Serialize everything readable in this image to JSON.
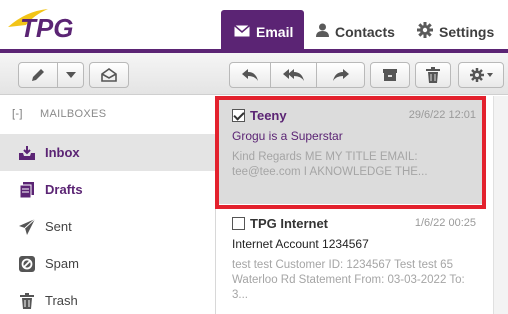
{
  "header": {
    "logo_text": "TPG",
    "tabs": [
      {
        "label": "Email",
        "icon": "envelope-icon",
        "active": true
      },
      {
        "label": "Contacts",
        "icon": "person-icon",
        "active": false
      },
      {
        "label": "Settings",
        "icon": "gear-icon",
        "active": false
      }
    ]
  },
  "toolbar": {
    "buttons": [
      "compose-icon",
      "chevron-down-icon",
      "mark-read-icon",
      "reply-icon",
      "reply-all-icon",
      "forward-icon",
      "archive-icon",
      "trash-icon",
      "gear-icon"
    ]
  },
  "sidebar": {
    "toggle": "[-]",
    "heading": "MAILBOXES",
    "folders": [
      {
        "label": "Inbox",
        "icon": "inbox-icon",
        "active": true
      },
      {
        "label": "Drafts",
        "icon": "drafts-icon",
        "active": false
      },
      {
        "label": "Sent",
        "icon": "send-icon",
        "active": false
      },
      {
        "label": "Spam",
        "icon": "spam-icon",
        "active": false
      },
      {
        "label": "Trash",
        "icon": "trash-icon",
        "active": false
      }
    ]
  },
  "messages": [
    {
      "sender": "Teeny",
      "date": "29/6/22 12:01",
      "subject": "Grogu is a Superstar",
      "preview": "Kind Regards ME MY TITLE EMAIL: tee@tee.com I AKNOWLEDGE THE...",
      "checked": true,
      "selected": true
    },
    {
      "sender": "TPG Internet",
      "date": "1/6/22 00:25",
      "subject": "Internet Account 1234567",
      "preview": "test test Customer ID: 1234567 Test test 65 Waterloo Rd Statement From: 03-03-2022 To: 3...",
      "checked": false,
      "selected": false
    }
  ],
  "colors": {
    "brand_purple": "#5b2474",
    "logo_yellow": "#f2c418",
    "highlight_red": "#e3212d"
  }
}
